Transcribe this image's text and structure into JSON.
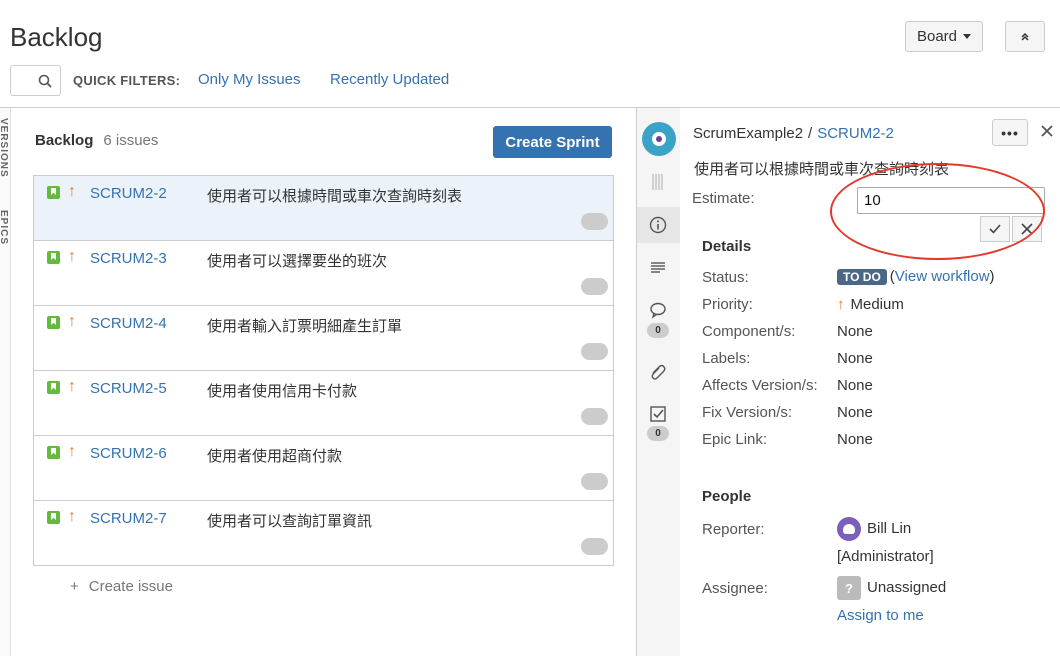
{
  "page": {
    "title": "Backlog"
  },
  "toolbar": {
    "board_label": "Board",
    "collapse_glyph": "⌃⌃"
  },
  "filters": {
    "label": "QUICK FILTERS:",
    "only_my_issues": "Only My Issues",
    "recently_updated": "Recently Updated"
  },
  "rail": {
    "versions": "VERSIONS",
    "epics": "EPICS"
  },
  "backlog": {
    "heading": "Backlog",
    "count": "6 issues",
    "create_sprint": "Create Sprint",
    "create_issue": "Create issue",
    "issues": [
      {
        "key": "SCRUM2-2",
        "summary": "使用者可以根據時間或車次查詢時刻表",
        "selected": true
      },
      {
        "key": "SCRUM2-3",
        "summary": "使用者可以選擇要坐的班次"
      },
      {
        "key": "SCRUM2-4",
        "summary": "使用者輸入訂票明細產生訂單"
      },
      {
        "key": "SCRUM2-5",
        "summary": "使用者使用信用卡付款"
      },
      {
        "key": "SCRUM2-6",
        "summary": "使用者使用超商付款"
      },
      {
        "key": "SCRUM2-7",
        "summary": "使用者可以查詢訂單資訊"
      }
    ]
  },
  "tools": {
    "comments_count": "0",
    "subtasks_count": "0"
  },
  "detail": {
    "project": "ScrumExample2",
    "separator": "/",
    "issue_key": "SCRUM2-2",
    "more": "•••",
    "summary": "使用者可以根據時間或車次查詢時刻表",
    "estimate_label": "Estimate:",
    "estimate_value": "10",
    "details_heading": "Details",
    "fields": {
      "status_label": "Status:",
      "status_value": "TO DO",
      "view_workflow": "View workflow",
      "priority_label": "Priority:",
      "priority_value": "Medium",
      "components_label": "Component/s:",
      "components_value": "None",
      "labels_label": "Labels:",
      "labels_value": "None",
      "affects_label": "Affects Version/s:",
      "affects_value": "None",
      "fix_label": "Fix Version/s:",
      "fix_value": "None",
      "epic_label": "Epic Link:",
      "epic_value": "None"
    },
    "people_heading": "People",
    "reporter_label": "Reporter:",
    "reporter_name": "Bill Lin",
    "reporter_role": "[Administrator]",
    "assignee_label": "Assignee:",
    "assignee_value": "Unassigned",
    "assign_to_me": "Assign to me"
  },
  "colors": {
    "accent": "#3572b0",
    "story": "#63ba3c",
    "priority": "#ea7d24",
    "annotation": "#e23b2e"
  }
}
